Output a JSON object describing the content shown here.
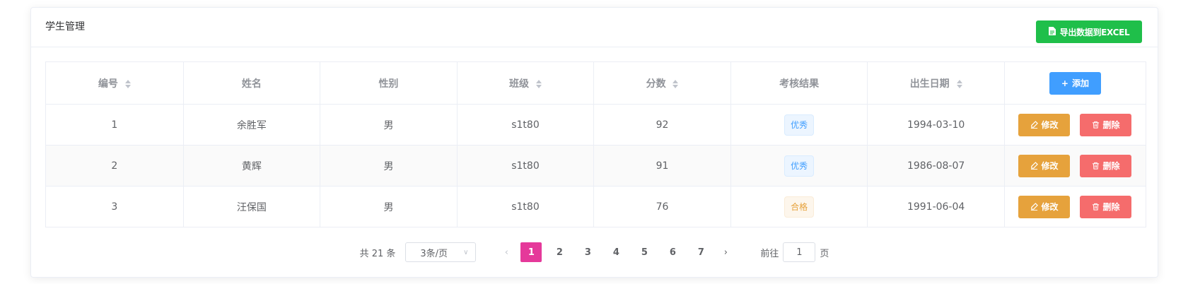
{
  "card": {
    "title": "学生管理",
    "export_label": "导出数据到EXCEL"
  },
  "table": {
    "headers": {
      "id": "编号",
      "name": "姓名",
      "gender": "性别",
      "class": "班级",
      "score": "分数",
      "result": "考核结果",
      "birth": "出生日期"
    },
    "add_label": "添加",
    "edit_label": "修改",
    "delete_label": "删除",
    "rows": [
      {
        "id": "1",
        "name": "余胜军",
        "gender": "男",
        "class": "s1t80",
        "score": "92",
        "result": "优秀",
        "result_color": "#409eff",
        "birth": "1994-03-10"
      },
      {
        "id": "2",
        "name": "黄辉",
        "gender": "男",
        "class": "s1t80",
        "score": "91",
        "result": "优秀",
        "result_color": "#409eff",
        "birth": "1986-08-07"
      },
      {
        "id": "3",
        "name": "汪保国",
        "gender": "男",
        "class": "s1t80",
        "score": "76",
        "result": "合格",
        "result_color": "#e6a23c",
        "birth": "1991-06-04"
      }
    ]
  },
  "pagination": {
    "total_text": "共 21 条",
    "page_size": "3条/页",
    "pages": [
      "1",
      "2",
      "3",
      "4",
      "5",
      "6",
      "7"
    ],
    "current_page": "1",
    "goto_label": "前往",
    "goto_value": "1",
    "page_suffix": "页",
    "active_color": "#e5399a"
  },
  "colors": {
    "export_button": "#1fbf4a",
    "add_button": "#409eff",
    "edit_button": "#e6a23c",
    "delete_button": "#f56c6c"
  }
}
